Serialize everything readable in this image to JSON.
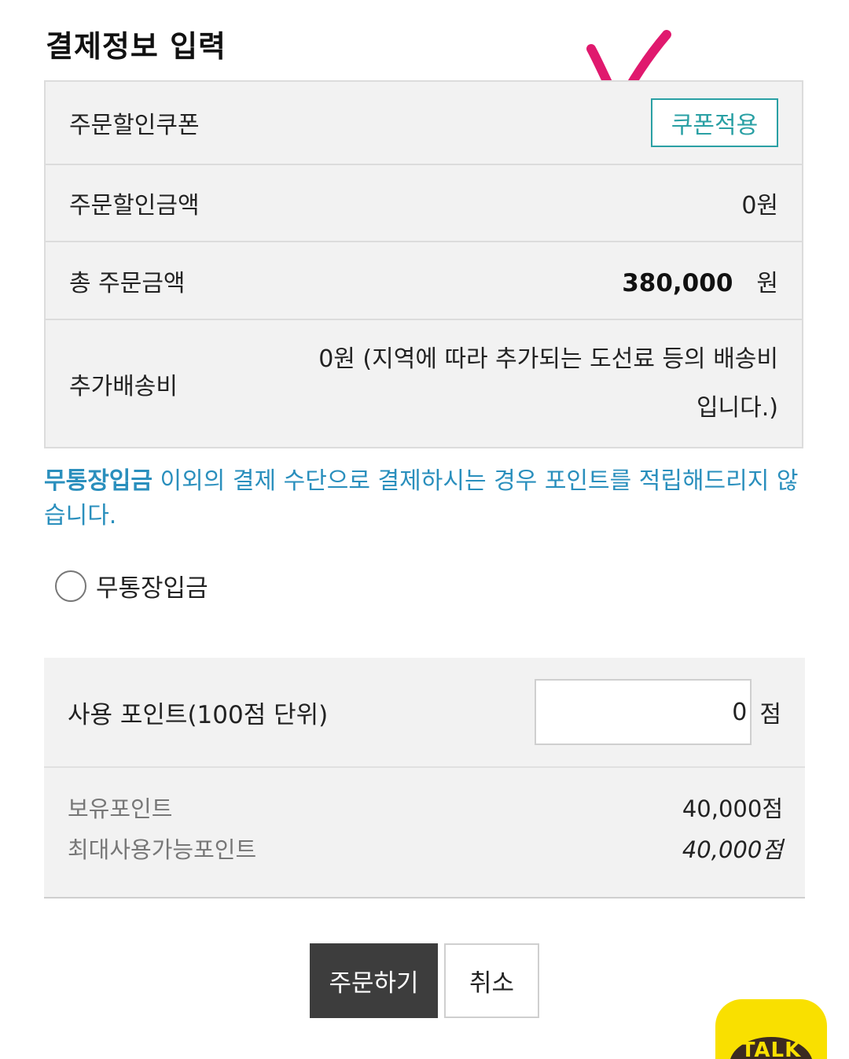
{
  "page": {
    "title": "결제정보 입력"
  },
  "payment_info": {
    "coupon_label": "주문할인쿠폰",
    "coupon_button": "쿠폰적용",
    "discount_label": "주문할인금액",
    "discount_value": "0원",
    "total_label": "총 주문금액",
    "total_amount": "380,000",
    "total_unit": "원",
    "shipping_label": "추가배송비",
    "shipping_value": "0원 (지역에 따라 추가되는 도선료 등의 배송비입니다.)"
  },
  "notice": {
    "highlight": "무통장입금",
    "text": " 이외의 결제 수단으로 결제하시는 경우 포인트를 적립해드리지 않습니다."
  },
  "payment_method": {
    "label": "무통장입금"
  },
  "points": {
    "label": "사용 포인트(100점 단위)",
    "input_value": "0",
    "unit": "점",
    "owned_label": "보유포인트",
    "owned_value": "40,000점",
    "max_label": "최대사용가능포인트",
    "max_value": "40,000점"
  },
  "buttons": {
    "order": "주문하기",
    "cancel": "취소"
  },
  "chat": {
    "label": "TALK"
  },
  "colors": {
    "accent": "#2aa0a4",
    "notice": "#2a8fbd",
    "panel": "#f2f2f2",
    "dark_button": "#3d3d3d",
    "kakao_yellow": "#f9e000",
    "annotation": "#e0196e"
  }
}
